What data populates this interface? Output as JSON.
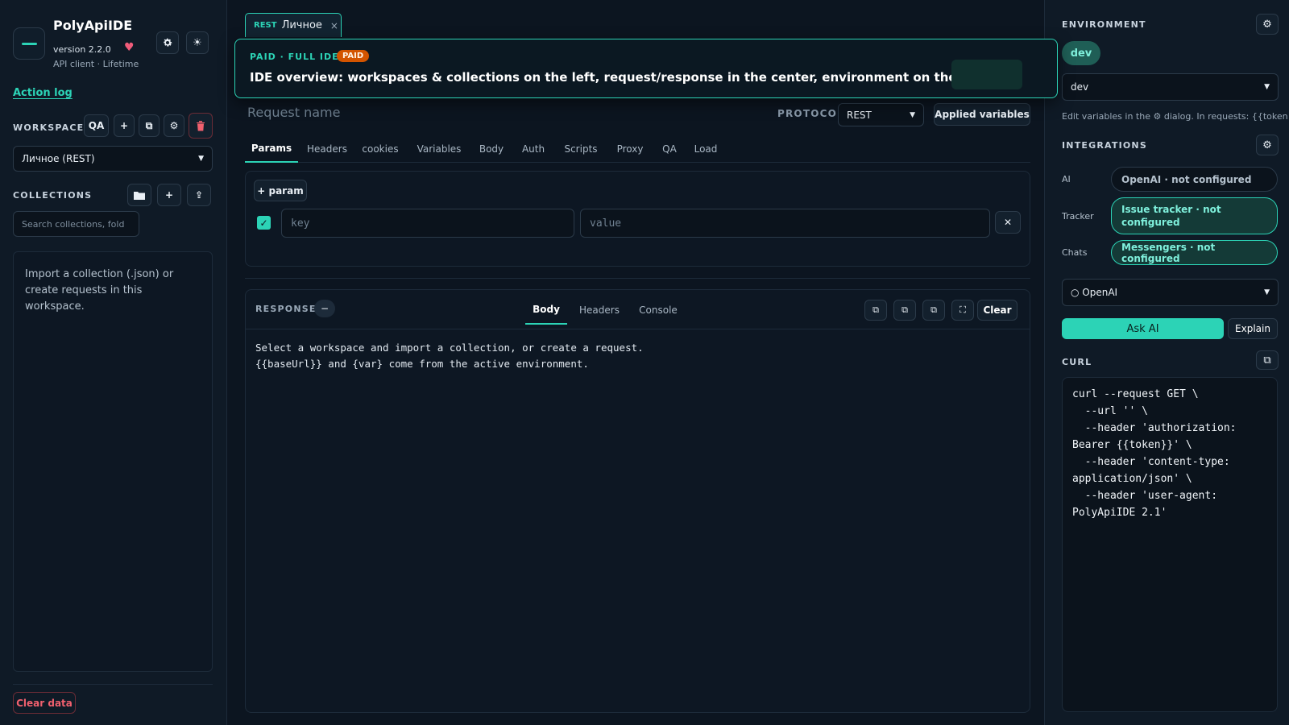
{
  "app": {
    "name": "PolyApiIDE",
    "version": "version 2.2.0",
    "subtitle": "API client · Lifetime"
  },
  "sidebar": {
    "action_log": "Action log",
    "workspace_label": "WORKSPACE",
    "workspace_mode": "QA",
    "workspace_select": "Личное (REST)",
    "collections_label": "COLLECTIONS",
    "search_placeholder": "Search collections, fold",
    "empty_text": "Import a collection (.json) or create requests in this workspace.",
    "clear_data": "Clear data"
  },
  "tab": {
    "protocol": "REST",
    "name": "Личное",
    "close": "×"
  },
  "banner": {
    "kicker": "PAID · FULL IDE",
    "badge": "PAID",
    "message": "IDE overview: workspaces & collections on the left, request/response in the center, environment on the right."
  },
  "request": {
    "name_placeholder": "Request name",
    "protocol_label": "PROTOCOL",
    "protocol_value": "REST",
    "applied_variables": "Applied variables",
    "tabs": [
      "Params",
      "Headers",
      "cookies",
      "Variables",
      "Body",
      "Auth",
      "Scripts",
      "Proxy",
      "QA",
      "Load"
    ],
    "active_tab": "Params",
    "add_param": "+ param",
    "key_placeholder": "key",
    "value_placeholder": "value"
  },
  "response": {
    "label": "RESPONSE",
    "tabs": [
      "Body",
      "Headers",
      "Console"
    ],
    "active_tab": "Body",
    "clear": "Clear",
    "body_text": "Select a workspace and import a collection, or create a request.\n{{baseUrl}} and {var} come from the active environment."
  },
  "environment": {
    "label": "ENVIRONMENT",
    "active": "dev",
    "select": "dev",
    "hint": "Edit variables in the ⚙ dialog. In requests: {{token}}."
  },
  "integrations": {
    "label": "INTEGRATIONS",
    "ai_label": "AI",
    "ai_status": "OpenAI · not configured",
    "tracker_label": "Tracker",
    "tracker_status": "Issue tracker · not configured",
    "chats_label": "Chats",
    "chats_status": "Messengers · not configured",
    "model_select": "○ OpenAI",
    "ask_ai": "Ask AI",
    "explain": "Explain"
  },
  "curl": {
    "label": "CURL",
    "text": "curl --request GET \\\n  --url '' \\\n  --header 'authorization: Bearer {{token}}' \\\n  --header 'content-type: application/json' \\\n  --header 'user-agent: PolyApiIDE 2.1'"
  },
  "colors": {
    "accent": "#2cd3b6",
    "background": "#0c1520",
    "panel": "#0f1a26",
    "danger": "#f0606e",
    "paid_badge": "#d35400"
  },
  "icons": {
    "settings": "gear-icon",
    "theme": "sun-icon",
    "heart": "heart-icon",
    "delete": "trash-icon",
    "folder": "folder-icon",
    "upload": "upload-icon",
    "copy": "copy-icon",
    "fullscreen": "fullscreen-icon"
  }
}
